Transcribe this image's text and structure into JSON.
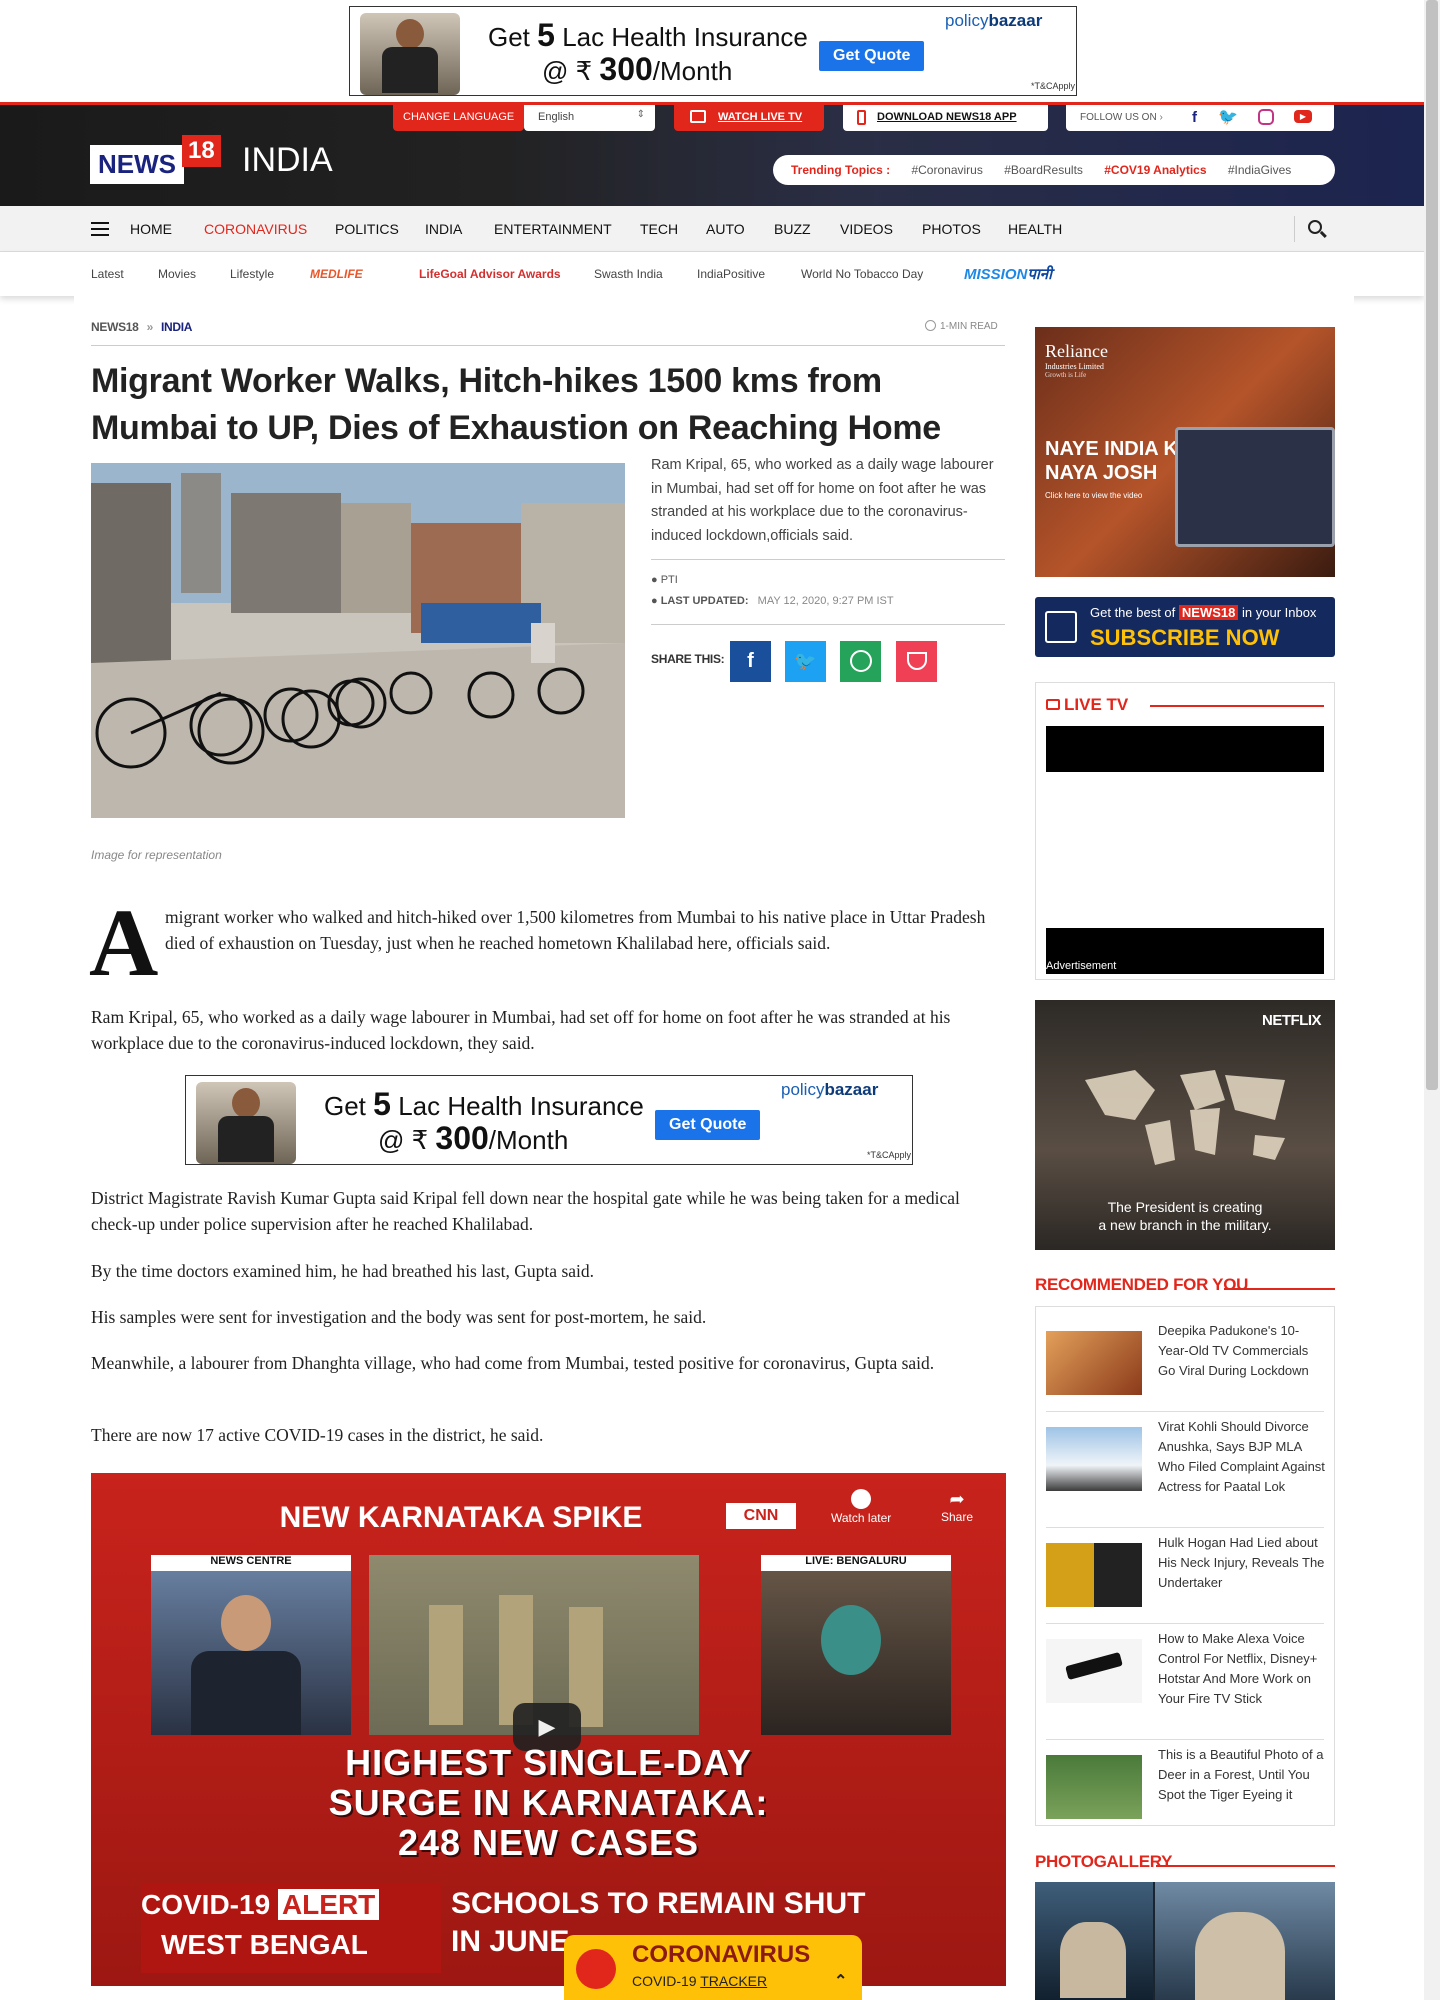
{
  "top_ad": {
    "line1_pre": "Get",
    "line1_num": "5",
    "line1_post": "Lac Health Insurance",
    "line2_pre": "@ ₹",
    "line2_num": "300",
    "line2_post": "/Month",
    "button": "Get Quote",
    "brand_a": "policy",
    "brand_b": "bazaar",
    "tc": "*T&CApply"
  },
  "header": {
    "logo_news": "NEWS",
    "logo_18": "18",
    "edition": "INDIA",
    "change_language": "CHANGE LANGUAGE",
    "language_value": "English",
    "watch_live": "WATCH LIVE TV",
    "download_app": "DOWNLOAD NEWS18 APP",
    "follow_us": "FOLLOW US ON",
    "trending_label": "Trending Topics :",
    "trending": [
      "#Coronavirus",
      "#BoardResults",
      "#COV19 Analytics",
      "#IndiaGives"
    ]
  },
  "nav": {
    "items": [
      "HOME",
      "CORONAVIRUS",
      "POLITICS",
      "INDIA",
      "ENTERTAINMENT",
      "TECH",
      "AUTO",
      "BUZZ",
      "VIDEOS",
      "PHOTOS",
      "HEALTH"
    ]
  },
  "subnav": {
    "items": [
      "Latest",
      "Movies",
      "Lifestyle",
      "MEDLIFE",
      "LifeGoal Advisor Awards",
      "Swasth India",
      "IndiaPositive",
      "World No Tobacco Day"
    ],
    "mission_a": "MISSION",
    "mission_b": "पानी"
  },
  "article": {
    "breadcrumb": [
      "NEWS18",
      "INDIA"
    ],
    "read_time": "1-MIN READ",
    "title": "Migrant Worker Walks, Hitch-hikes 1500 kms from Mumbai to UP, Dies of Exhaustion on Reaching Home",
    "summary": "Ram Kripal, 65, who worked as a daily wage labourer in Mumbai, had set off for home on foot after he was stranded at his workplace due to the coronavirus-induced lockdown,officials said.",
    "source": "PTI",
    "updated_label": "LAST UPDATED:",
    "updated_value": "MAY 12, 2020, 9:27 PM IST",
    "share_label": "SHARE THIS:",
    "image_caption": "Image for representation",
    "dropcap": "A",
    "p1": "migrant worker who walked and hitch-hiked over 1,500 kilometres from Mumbai to his native place in Uttar Pradesh died of exhaustion on Tuesday, just when he reached hometown Khalilabad here, officials said.",
    "p2": "Ram Kripal, 65, who worked as a daily wage labourer in Mumbai, had set off for home on foot after he was stranded at his workplace due to the coronavirus-induced lockdown, they said.",
    "p3": "District Magistrate Ravish Kumar Gupta said Kripal fell down near the hospital gate while he was being taken for a medical check-up under police supervision after he reached Khalilabad.",
    "p4": "By the time doctors examined him, he had breathed his last, Gupta said.",
    "p5": "His samples were sent for investigation and the body was sent for post-mortem, he said.",
    "p6": "Meanwhile, a labourer from Dhanghta village, who had come from Mumbai, tested positive for coronavirus, Gupta said.",
    "p7": "There are now 17 active COVID-19 cases in the district, he said."
  },
  "video": {
    "top_banner": "NEW KARNATAKA SPIKE",
    "news_centre": "NEWS CENTRE",
    "live_label": "LIVE: BENGALURU",
    "watch_later": "Watch later",
    "share": "Share",
    "headline_l1": "HIGHEST SINGLE-DAY",
    "headline_l2": "SURGE IN KARNATAKA:",
    "headline_l3": "248 NEW CASES",
    "alert_a": "COVID-19",
    "alert_b": "ALERT",
    "alert_region": "WEST BENGAL",
    "ticker_l1": "SCHOOLS TO REMAIN SHUT",
    "ticker_l2": "IN JUNE"
  },
  "sidebar": {
    "ad1": {
      "brand": "Reliance",
      "brand_sub": "Industries Limited",
      "tag": "Growth is Life",
      "headline_l1": "NAYE INDIA KA",
      "headline_l2": "NAYA JOSH",
      "cta": "Click here to view the video"
    },
    "subscribe": {
      "line1_a": "Get the best of",
      "line1_b": "NEWS18",
      "line1_c": "in your Inbox",
      "line2": "SUBSCRIBE NOW"
    },
    "livetv_title": "LIVE TV",
    "advertisement": "Advertisement",
    "netflix": {
      "brand": "NETFLIX",
      "caption_l1": "The President is creating",
      "caption_l2": "a new branch in the military."
    },
    "recommended_title": "RECOMMENDED FOR YOU",
    "recommended": [
      "Deepika Padukone's 10-Year-Old TV Commercials Go Viral During Lockdown",
      "Virat Kohli Should Divorce Anushka, Says BJP MLA Who Filed Complaint Against Actress for Paatal Lok",
      "Hulk Hogan Had Lied about His Neck Injury, Reveals The Undertaker",
      "How to Make Alexa Voice Control For Netflix, Disney+ Hotstar And More Work on Your Fire TV Stick",
      "This is a Beautiful Photo of a Deer in a Forest, Until You Spot the Tiger Eyeing it"
    ],
    "photogallery_title": "PHOTOGALLERY"
  },
  "covid_widget": {
    "title": "CORONAVIRUS",
    "sub_a": "COVID-19",
    "sub_b": "TRACKER"
  }
}
